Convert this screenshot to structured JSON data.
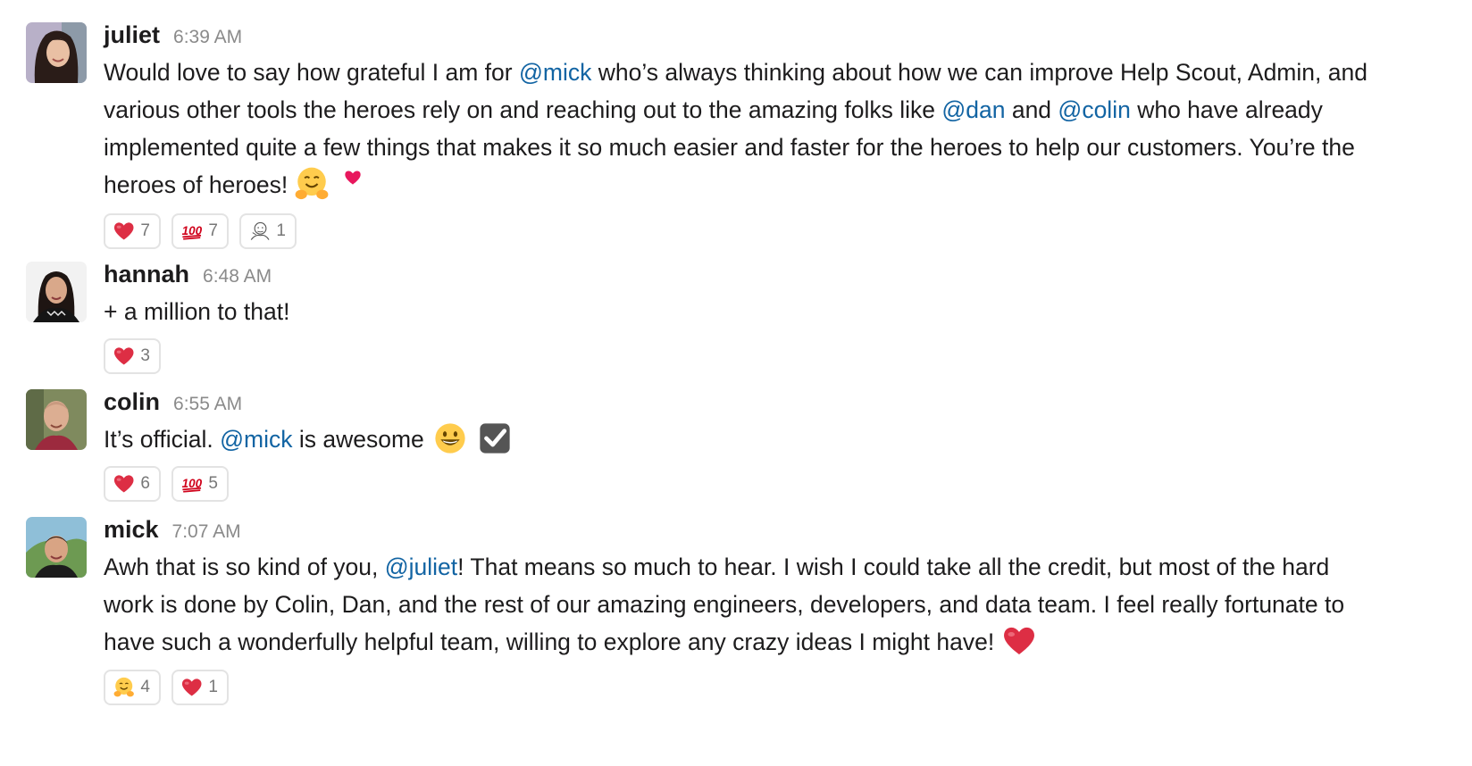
{
  "messages": [
    {
      "author": "juliet",
      "time": "6:39 AM",
      "segments": {
        "t1": "Would love to say how grateful I am for ",
        "m1": "@mick",
        "t2": " who’s always thinking about how we can improve Help Scout, Admin, and various other tools the heroes rely on and reaching out to the amazing folks like ",
        "m2": "@dan",
        "t3": " and ",
        "m3": "@colin",
        "t4": " who have already implemented quite a few things that makes it so much easier and faster for the heroes to help our customers. You’re the heroes of heroes!"
      },
      "inline_emoji": [
        "hugging-face",
        "pink-heart"
      ],
      "reactions": [
        {
          "icon": "red-heart",
          "count": "7"
        },
        {
          "icon": "hundred-points",
          "count": "7"
        },
        {
          "icon": "custom-sketch",
          "count": "1"
        }
      ]
    },
    {
      "author": "hannah",
      "time": "6:48 AM",
      "segments": {
        "t1": "+ a million to that!"
      },
      "reactions": [
        {
          "icon": "red-heart",
          "count": "3"
        }
      ]
    },
    {
      "author": "colin",
      "time": "6:55 AM",
      "segments": {
        "t1": "It’s official. ",
        "m1": "@mick",
        "t2": " is awesome"
      },
      "inline_emoji": [
        "grinning-face",
        "check-box"
      ],
      "reactions": [
        {
          "icon": "red-heart",
          "count": "6"
        },
        {
          "icon": "hundred-points",
          "count": "5"
        }
      ]
    },
    {
      "author": "mick",
      "time": "7:07 AM",
      "segments": {
        "t1": "Awh that is so kind of you, ",
        "m1": "@juliet",
        "t2": "! That means so much to hear. I wish I could take all the credit, but most of the hard work is done by Colin, Dan, and the rest of our amazing engineers, developers, and data team. I feel really fortunate to have such a wonderfully helpful team, willing to explore any crazy ideas I might have!"
      },
      "inline_emoji": [
        "red-heart"
      ],
      "reactions": [
        {
          "icon": "hugging-face",
          "count": "4"
        },
        {
          "icon": "red-heart",
          "count": "1"
        }
      ]
    }
  ],
  "colors": {
    "mention": "#1264a3",
    "timestamp": "#8a8a8a",
    "reaction_border": "#e3e3e3"
  }
}
